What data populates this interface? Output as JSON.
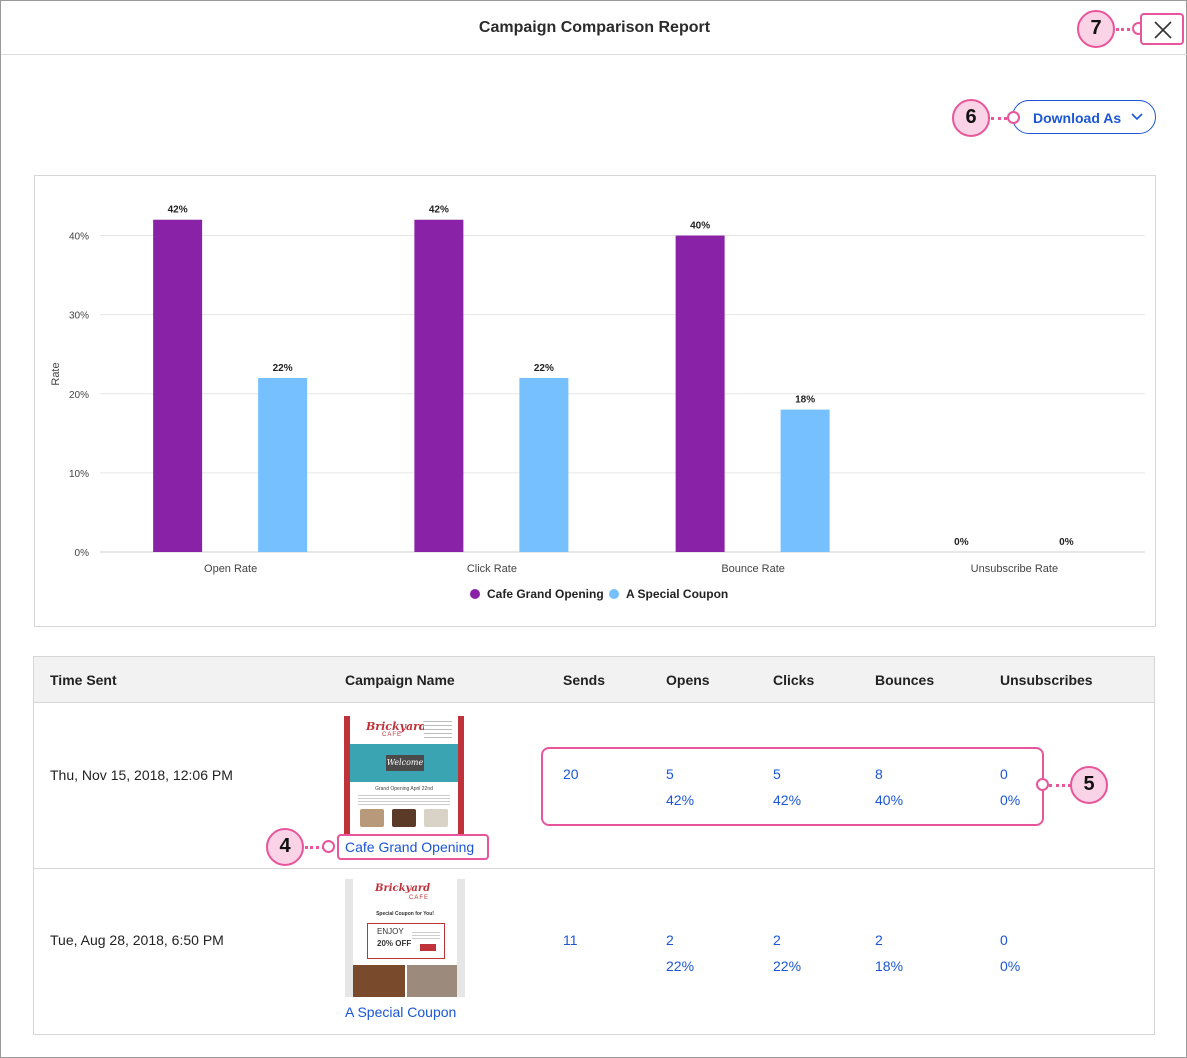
{
  "header": {
    "title": "Campaign Comparison Report"
  },
  "download": {
    "label": "Download As"
  },
  "callouts": {
    "c4": "4",
    "c5": "5",
    "c6": "6",
    "c7": "7"
  },
  "chart_data": {
    "type": "bar",
    "categories": [
      "Open Rate",
      "Click Rate",
      "Bounce Rate",
      "Unsubscribe Rate"
    ],
    "series": [
      {
        "name": "Cafe Grand Opening",
        "color": "#8a22a8",
        "values": [
          42,
          42,
          40,
          0
        ],
        "labels": [
          "42%",
          "42%",
          "40%",
          "0%"
        ]
      },
      {
        "name": "A Special Coupon",
        "color": "#76c0ff",
        "values": [
          22,
          22,
          18,
          0
        ],
        "labels": [
          "22%",
          "22%",
          "18%",
          "0%"
        ]
      }
    ],
    "ylabel": "Rate",
    "ylim": [
      0,
      45
    ],
    "yticks": [
      0,
      10,
      20,
      30,
      40
    ],
    "ytick_labels": [
      "0%",
      "10%",
      "20%",
      "30%",
      "40%"
    ],
    "grid": true,
    "legend": "bottom-center"
  },
  "table": {
    "headers": [
      "Time Sent",
      "Campaign Name",
      "Sends",
      "Opens",
      "Clicks",
      "Bounces",
      "Unsubscribes"
    ],
    "rows": [
      {
        "time": "Thu, Nov 15, 2018, 12:06 PM",
        "name": "Cafe Grand Opening",
        "sends": "20",
        "opens": "5",
        "opens_pct": "42%",
        "clicks": "5",
        "clicks_pct": "42%",
        "bounces": "8",
        "bounces_pct": "40%",
        "unsubs": "0",
        "unsubs_pct": "0%",
        "thumb": {
          "brand_1": "Brickyard",
          "brand_2": "CAFE",
          "banner": "Welcome",
          "subtitle": "Grand Opening April 22nd"
        }
      },
      {
        "time": "Tue, Aug 28, 2018, 6:50 PM",
        "name": "A Special Coupon",
        "sends": "11",
        "opens": "2",
        "opens_pct": "22%",
        "clicks": "2",
        "clicks_pct": "22%",
        "bounces": "2",
        "bounces_pct": "18%",
        "unsubs": "0",
        "unsubs_pct": "0%",
        "thumb": {
          "brand_1": "Brickyard",
          "brand_2": "CAFE",
          "subtitle": "Special Coupon for You!",
          "offer_1": "ENJOY",
          "offer_2": "20% OFF"
        }
      }
    ]
  }
}
